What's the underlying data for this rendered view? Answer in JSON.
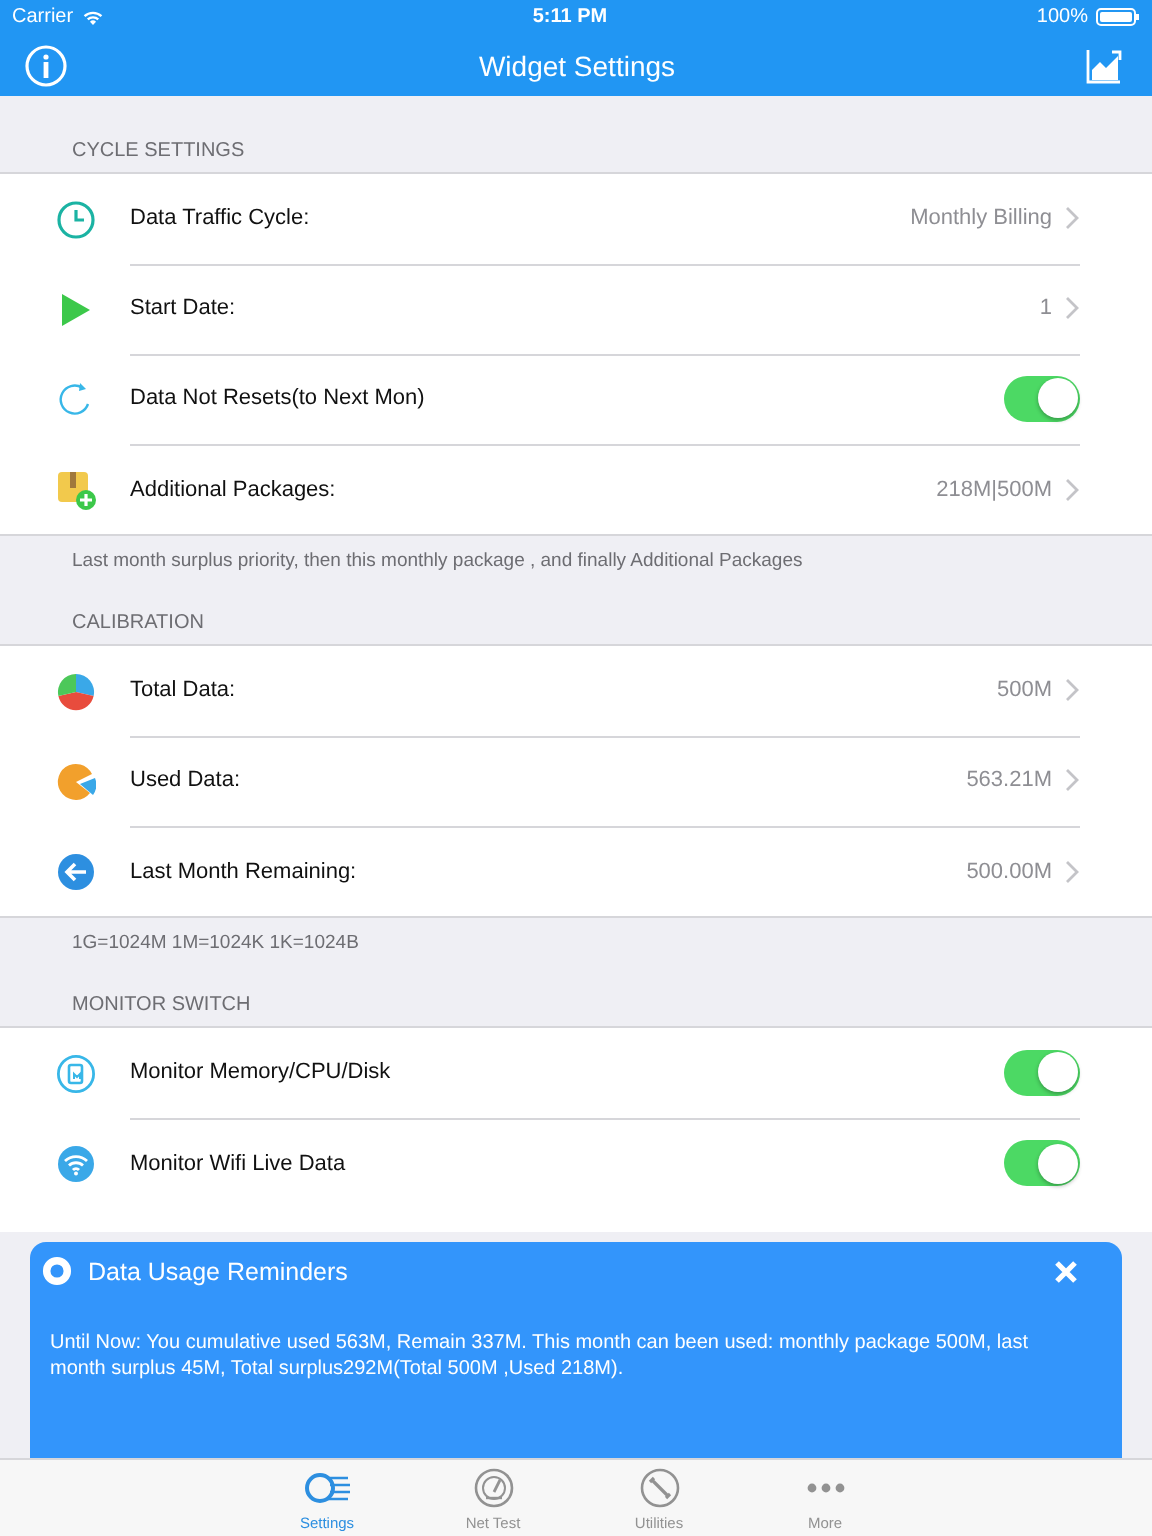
{
  "status_bar": {
    "carrier": "Carrier",
    "time": "5:11 PM",
    "battery": "100%"
  },
  "nav_bar": {
    "title": "Widget Settings"
  },
  "sections": [
    {
      "header": "CYCLE SETTINGS",
      "footer": "Last month surplus priority, then this monthly package , and finally Additional Packages",
      "rows": [
        {
          "kind": "link",
          "label": "Data Traffic Cycle:",
          "value": "Monthly Billing"
        },
        {
          "kind": "link",
          "label": "Start Date:",
          "value": "1"
        },
        {
          "kind": "toggle",
          "label": "Data Not Resets(to Next Mon)",
          "on": true
        },
        {
          "kind": "link",
          "label": "Additional Packages:",
          "value": "218M|500M"
        }
      ]
    },
    {
      "header": "CALIBRATION",
      "footer": "1G=1024M  1M=1024K  1K=1024B",
      "rows": [
        {
          "kind": "link",
          "label": "Total Data:",
          "value": "500M"
        },
        {
          "kind": "link",
          "label": "Used Data:",
          "value": "563.21M"
        },
        {
          "kind": "link",
          "label": "Last Month Remaining:",
          "value": "500.00M"
        }
      ]
    },
    {
      "header": "MONITOR SWITCH",
      "rows": [
        {
          "kind": "toggle",
          "label": "Monitor Memory/CPU/Disk",
          "on": true
        },
        {
          "kind": "toggle",
          "label": "Monitor Wifi Live Data",
          "on": true
        }
      ]
    }
  ],
  "banner": {
    "title": "Data Usage Reminders",
    "message": "Until Now: You cumulative used 563M, Remain 337M. This month can been used: monthly package 500M, last month surplus 45M, Total surplus292M(Total 500M ,Used 218M)."
  },
  "tab_bar": [
    {
      "label": "Settings",
      "selected": true
    },
    {
      "label": "Net Test",
      "selected": false
    },
    {
      "label": "Utilities",
      "selected": false
    },
    {
      "label": "More",
      "selected": false
    }
  ]
}
